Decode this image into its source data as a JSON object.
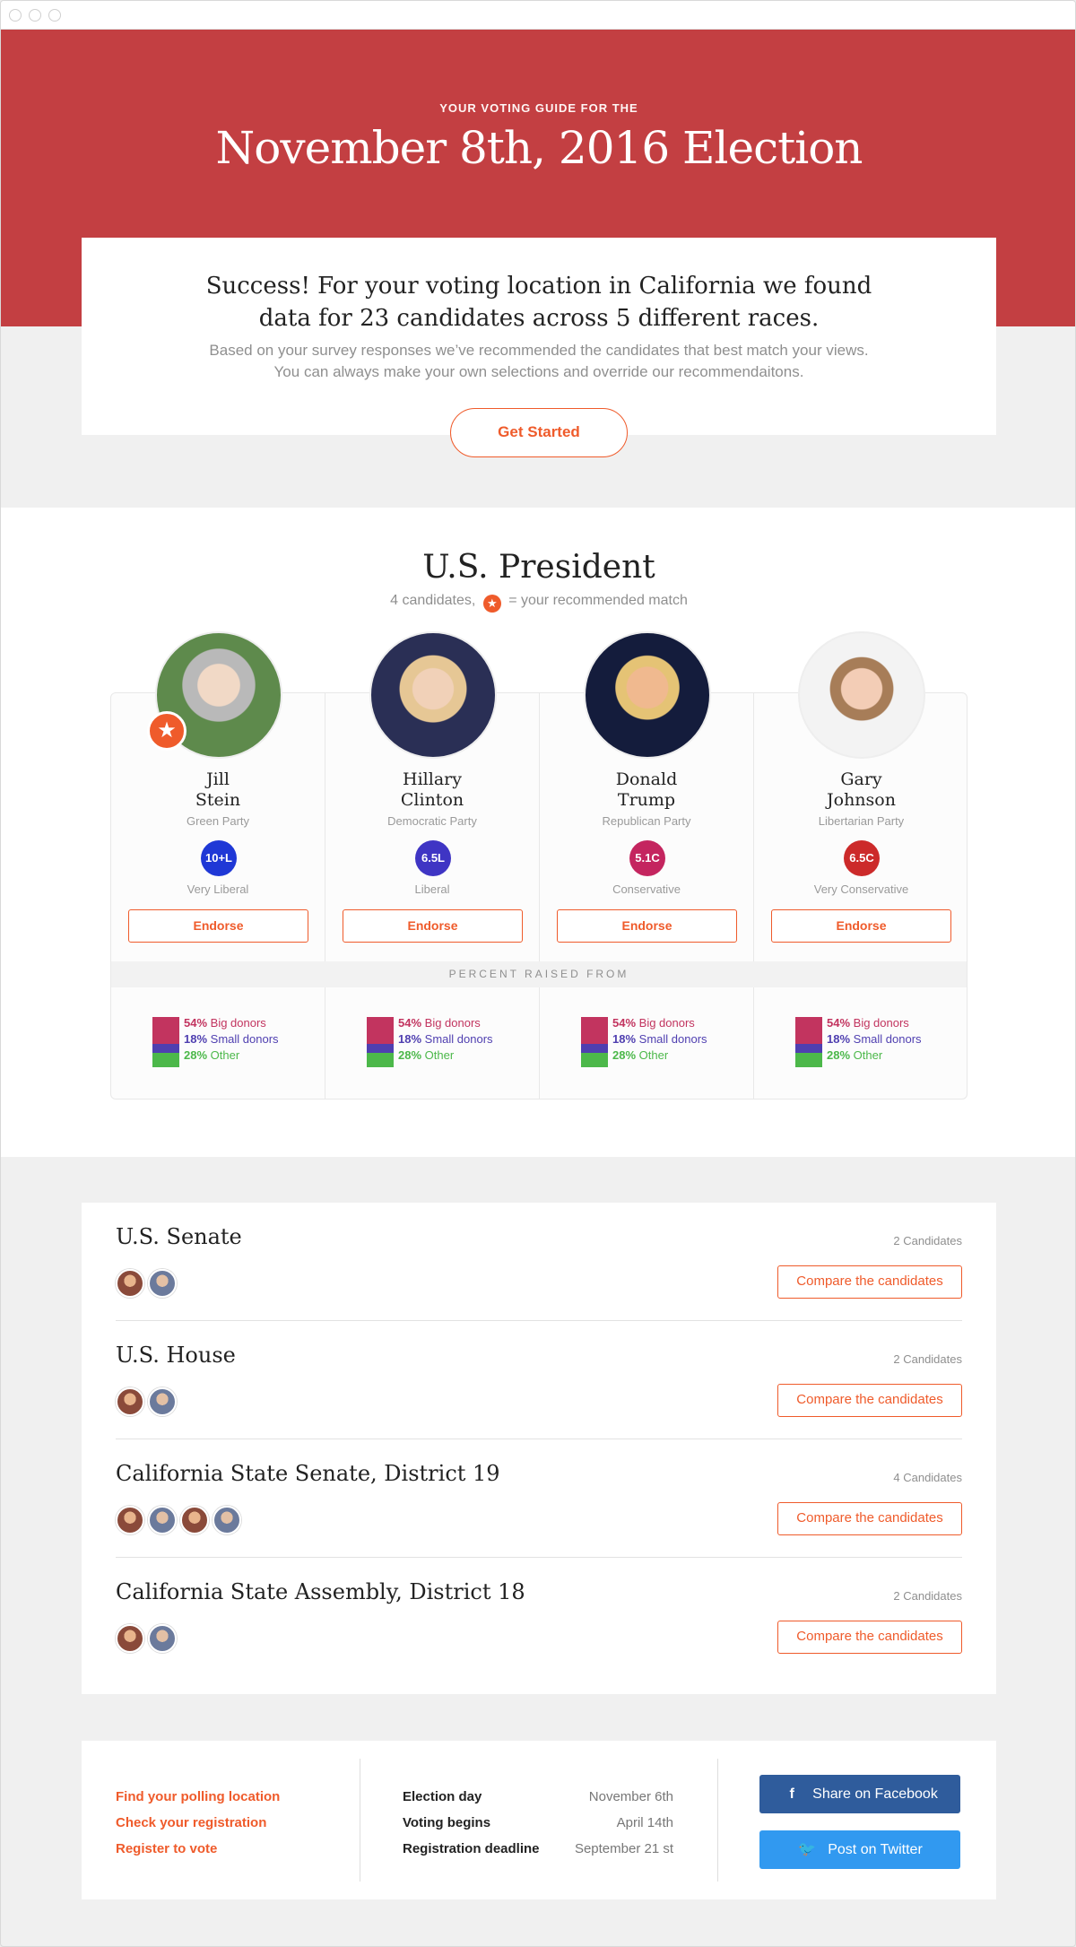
{
  "hero": {
    "kicker": "YOUR VOTING GUIDE FOR THE",
    "title": "November 8th, 2016  Election",
    "bg_color": "#c33f42"
  },
  "success": {
    "headline_line1": "Success! For your voting location in California we found",
    "headline_line2": "data for 23 candidates across 5 different races.",
    "sub_line1": "Based on your survey responses we’ve recommended the candidates that best match your views.",
    "sub_line2": "You can always make your own selections and override our recommendaitons.",
    "button_label": "Get Started"
  },
  "president": {
    "title": "U.S. President",
    "subtitle_count": "4 candidates,",
    "subtitle_legend": "= your recommended match",
    "percent_raised_label": "PERCENT RAISED FROM",
    "candidates": [
      {
        "first": "Jill",
        "last": "Stein",
        "party": "Green Party",
        "score": "10+L",
        "score_color": "#1f38d6",
        "ideology": "Very Liberal",
        "endorse_label": "Endorse",
        "recommended": true,
        "donors": {
          "big": "54%",
          "big_label": "Big donors",
          "small": "18%",
          "small_label": "Small donors",
          "other": "28%",
          "other_label": "Other"
        }
      },
      {
        "first": "Hillary",
        "last": "Clinton",
        "party": "Democratic Party",
        "score": "6.5L",
        "score_color": "#3f35c4",
        "ideology": "Liberal",
        "endorse_label": "Endorse",
        "recommended": false,
        "donors": {
          "big": "54%",
          "big_label": "Big donors",
          "small": "18%",
          "small_label": "Small donors",
          "other": "28%",
          "other_label": "Other"
        }
      },
      {
        "first": "Donald",
        "last": "Trump",
        "party": "Republican Party",
        "score": "5.1C",
        "score_color": "#c4255f",
        "ideology": "Conservative",
        "endorse_label": "Endorse",
        "recommended": false,
        "donors": {
          "big": "54%",
          "big_label": "Big donors",
          "small": "18%",
          "small_label": "Small donors",
          "other": "28%",
          "other_label": "Other"
        }
      },
      {
        "first": "Gary",
        "last": "Johnson",
        "party": "Libertarian Party",
        "score": "6.5C",
        "score_color": "#cc2a2a",
        "ideology": "Very Conservative",
        "endorse_label": "Endorse",
        "recommended": false,
        "donors": {
          "big": "54%",
          "big_label": "Big donors",
          "small": "18%",
          "small_label": "Small donors",
          "other": "28%",
          "other_label": "Other"
        }
      }
    ],
    "donor_colors": {
      "big": "#c2345f",
      "small": "#4f3fb0",
      "other": "#4cb84a"
    },
    "donor_fractions": {
      "big": 0.54,
      "small": 0.18,
      "other": 0.28
    }
  },
  "races": [
    {
      "title": "U.S. Senate",
      "count": "2 Candidates",
      "avatars": 2,
      "button": "Compare the candidates"
    },
    {
      "title": "U.S. House",
      "count": "2 Candidates",
      "avatars": 2,
      "button": "Compare the candidates"
    },
    {
      "title": "California State Senate, District 19",
      "count": "4 Candidates",
      "avatars": 4,
      "button": "Compare the candidates"
    },
    {
      "title": "California State Assembly, District 18",
      "count": "2 Candidates",
      "avatars": 2,
      "button": "Compare the candidates"
    }
  ],
  "footer": {
    "links": [
      "Find your polling location",
      "Check your registration",
      "Register to vote"
    ],
    "dates": [
      {
        "label": "Election day",
        "value": "November 6th"
      },
      {
        "label": "Voting begins",
        "value": "April 14th"
      },
      {
        "label": "Registration deadline",
        "value": "September 21 st"
      }
    ],
    "facebook_label": "Share on Facebook",
    "twitter_label": "Post on Twitter",
    "facebook_color": "#2f5c9c",
    "twitter_color": "#3199f0",
    "accent": "#ef5b2b"
  }
}
